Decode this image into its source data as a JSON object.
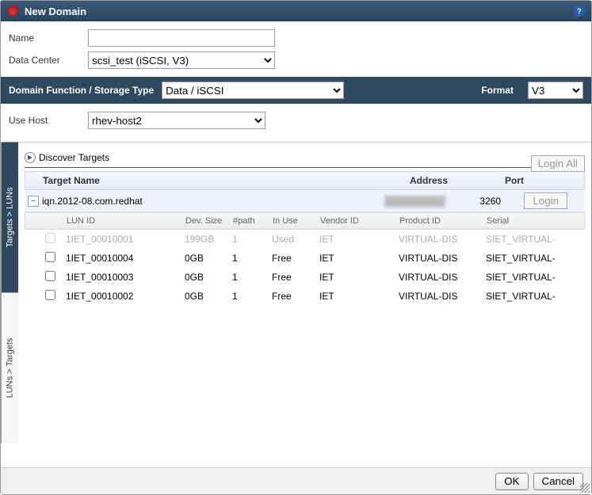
{
  "titlebar": {
    "title": "New Domain"
  },
  "form": {
    "name_label": "Name",
    "name_value": "",
    "datacenter_label": "Data Center",
    "datacenter_value": "scsi_test (iSCSI, V3)"
  },
  "storagebar": {
    "func_label": "Domain Function / Storage Type",
    "func_value": "Data / iSCSI",
    "format_label": "Format",
    "format_value": "V3"
  },
  "host": {
    "label": "Use Host",
    "value": "rhev-host2"
  },
  "sidetabs": {
    "active": "Targets > LUNs",
    "inactive": "LUNs > Targets"
  },
  "discover": {
    "label": "Discover Targets",
    "login_all": "Login All"
  },
  "targets_header": {
    "name": "Target Name",
    "address": "Address",
    "port": "Port"
  },
  "target": {
    "name": "iqn.2012-08.com.redhat",
    "address": "█████████",
    "port": "3260",
    "login": "Login"
  },
  "lun_header": {
    "id": "LUN ID",
    "size": "Dev. Size",
    "path": "#path",
    "inuse": "In Use",
    "vendor": "Vendor ID",
    "product": "Product ID",
    "serial": "Serial"
  },
  "luns": [
    {
      "id": "1IET_00010001",
      "size": "199GB",
      "path": "1",
      "use": "Used",
      "vendor": "IET",
      "product": "VIRTUAL-DIS",
      "serial": "SIET_VIRTUAL-",
      "disabled": true
    },
    {
      "id": "1IET_00010004",
      "size": "0GB",
      "path": "1",
      "use": "Free",
      "vendor": "IET",
      "product": "VIRTUAL-DIS",
      "serial": "SIET_VIRTUAL-",
      "disabled": false
    },
    {
      "id": "1IET_00010003",
      "size": "0GB",
      "path": "1",
      "use": "Free",
      "vendor": "IET",
      "product": "VIRTUAL-DIS",
      "serial": "SIET_VIRTUAL-",
      "disabled": false
    },
    {
      "id": "1IET_00010002",
      "size": "0GB",
      "path": "1",
      "use": "Free",
      "vendor": "IET",
      "product": "VIRTUAL-DIS",
      "serial": "SIET_VIRTUAL-",
      "disabled": false
    }
  ],
  "buttons": {
    "ok": "OK",
    "cancel": "Cancel"
  }
}
